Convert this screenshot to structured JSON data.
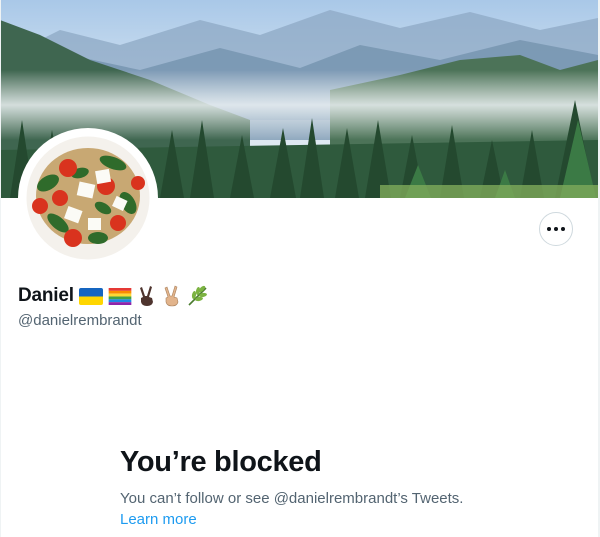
{
  "profile": {
    "display_name": "Daniel",
    "handle": "@danielrembrandt",
    "name_emojis": [
      "ukraine-flag",
      "rainbow-flag",
      "victory-hand-dark",
      "victory-hand-medium-light",
      "herb"
    ],
    "more_button_icon": "more-horizontal-icon"
  },
  "blocked": {
    "title": "You’re blocked",
    "message": "You can’t follow or see @danielrembrandt’s Tweets.",
    "learn_more": "Learn more"
  },
  "colors": {
    "primary_text": "#0f1419",
    "secondary_text": "#536471",
    "link": "#1d9bf0",
    "border": "#cfd9de"
  }
}
